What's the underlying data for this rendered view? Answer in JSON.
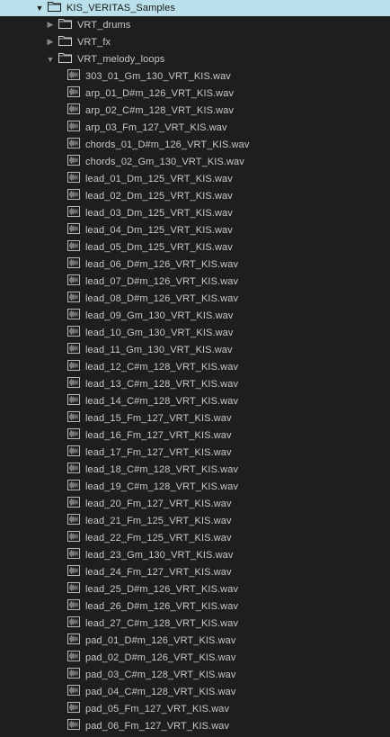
{
  "browser": {
    "root": {
      "label": "KIS_VERITAS_Samples",
      "expanded": true,
      "selected": true
    },
    "folders": [
      {
        "label": "VRT_drums",
        "expanded": false
      },
      {
        "label": "VRT_fx",
        "expanded": false
      },
      {
        "label": "VRT_melody_loops",
        "expanded": true
      }
    ],
    "files": [
      "303_01_Gm_130_VRT_KIS.wav",
      "arp_01_D#m_126_VRT_KIS.wav",
      "arp_02_C#m_128_VRT_KIS.wav",
      "arp_03_Fm_127_VRT_KIS.wav",
      "chords_01_D#m_126_VRT_KIS.wav",
      "chords_02_Gm_130_VRT_KIS.wav",
      "lead_01_Dm_125_VRT_KIS.wav",
      "lead_02_Dm_125_VRT_KIS.wav",
      "lead_03_Dm_125_VRT_KIS.wav",
      "lead_04_Dm_125_VRT_KIS.wav",
      "lead_05_Dm_125_VRT_KIS.wav",
      "lead_06_D#m_126_VRT_KIS.wav",
      "lead_07_D#m_126_VRT_KIS.wav",
      "lead_08_D#m_126_VRT_KIS.wav",
      "lead_09_Gm_130_VRT_KIS.wav",
      "lead_10_Gm_130_VRT_KIS.wav",
      "lead_11_Gm_130_VRT_KIS.wav",
      "lead_12_C#m_128_VRT_KIS.wav",
      "lead_13_C#m_128_VRT_KIS.wav",
      "lead_14_C#m_128_VRT_KIS.wav",
      "lead_15_Fm_127_VRT_KIS.wav",
      "lead_16_Fm_127_VRT_KIS.wav",
      "lead_17_Fm_127_VRT_KIS.wav",
      "lead_18_C#m_128_VRT_KIS.wav",
      "lead_19_C#m_128_VRT_KIS.wav",
      "lead_20_Fm_127_VRT_KIS.wav",
      "lead_21_Fm_125_VRT_KIS.wav",
      "lead_22_Fm_125_VRT_KIS.wav",
      "lead_23_Gm_130_VRT_KIS.wav",
      "lead_24_Fm_127_VRT_KIS.wav",
      "lead_25_D#m_126_VRT_KIS.wav",
      "lead_26_D#m_126_VRT_KIS.wav",
      "lead_27_C#m_128_VRT_KIS.wav",
      "pad_01_D#m_126_VRT_KIS.wav",
      "pad_02_D#m_126_VRT_KIS.wav",
      "pad_03_C#m_128_VRT_KIS.wav",
      "pad_04_C#m_128_VRT_KIS.wav",
      "pad_05_Fm_127_VRT_KIS.wav",
      "pad_06_Fm_127_VRT_KIS.wav"
    ]
  },
  "icons": {
    "expanded": "chevron-down-icon",
    "collapsed": "chevron-right-icon",
    "folder": "folder-icon",
    "file": "audio-file-icon"
  },
  "colors": {
    "background": "#1e1e1e",
    "text": "#c8c8c8",
    "selection": "#b9e0eb",
    "selection_text": "#1a1a1a",
    "folder_stroke": "#cfcfcf",
    "file_icon": "#b8b8b8"
  }
}
